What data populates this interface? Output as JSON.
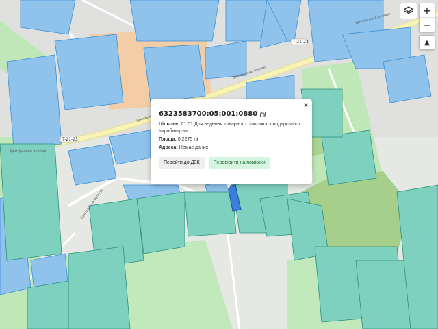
{
  "map": {
    "road_labels": [
      "Центральна вулиця",
      "Центральна вулиця",
      "Центральна вулиця",
      "Центральна вулиця",
      "Центральна вулиця"
    ],
    "route_shields": [
      "T-21-23",
      "T-21-23"
    ],
    "colors": {
      "parcel_blue": "#8fc3ec",
      "parcel_green": "#7fd1bf",
      "forest": "#a9cf8a",
      "grass": "#b9e7b4",
      "road": "#f6f3b0",
      "built": "#d8d8d8",
      "industrial": "#f3caa0",
      "selected": "#2f6fd0"
    }
  },
  "controls": {
    "layers_icon": "layers-icon",
    "zoom_in": "+",
    "zoom_out": "−",
    "compass": "▲"
  },
  "popup": {
    "cadastral_number": "6323583700:05:001:0880",
    "purpose_label": "Цільове:",
    "purpose_value": "01.01 Для ведення товарного сільськогосподарського виробництва",
    "area_label": "Площа:",
    "area_value": "0.2275 га",
    "address_label": "Адреса:",
    "address_value": "Немає даних",
    "btn_dzk": "Перейти до ДЗК",
    "btn_check": "Перевірити на помилки",
    "close": "×"
  }
}
